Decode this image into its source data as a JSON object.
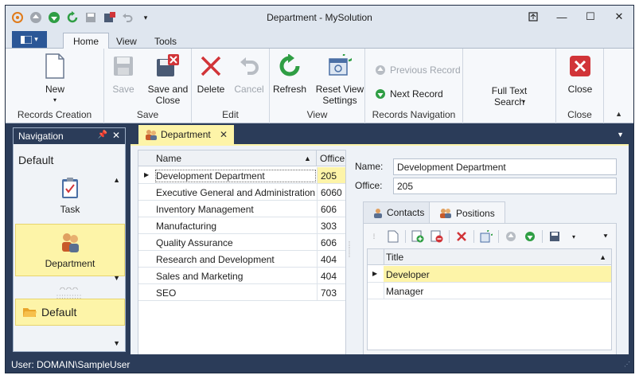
{
  "window": {
    "title": "Department - MySolution"
  },
  "ribbon": {
    "tabs": [
      "Home",
      "View",
      "Tools"
    ],
    "groups": {
      "records_creation": {
        "label": "Records Creation",
        "new_label": "New"
      },
      "save": {
        "label": "Save",
        "save_label": "Save",
        "save_close_label": "Save and Close"
      },
      "edit": {
        "label": "Edit",
        "delete_label": "Delete",
        "cancel_label": "Cancel"
      },
      "view": {
        "label": "View",
        "refresh_label": "Refresh",
        "reset_label": "Reset View Settings"
      },
      "records_navigation": {
        "label": "Records Navigation",
        "prev_label": "Previous Record",
        "next_label": "Next Record"
      },
      "search": {
        "label": "Full Text Search"
      },
      "close": {
        "label": "Close",
        "close_label": "Close"
      }
    }
  },
  "navigation": {
    "title": "Navigation",
    "group_label": "Default",
    "items": [
      {
        "label": "Task"
      },
      {
        "label": "Department"
      }
    ],
    "bottom_group": "Default"
  },
  "document": {
    "tab_label": "Department"
  },
  "grid": {
    "columns": [
      "Name",
      "Office"
    ],
    "rows": [
      {
        "name": "Development Department",
        "office": "205"
      },
      {
        "name": "Executive General and Administration",
        "office": "6060"
      },
      {
        "name": "Inventory Management",
        "office": "606"
      },
      {
        "name": "Manufacturing",
        "office": "303"
      },
      {
        "name": "Quality Assurance",
        "office": "606"
      },
      {
        "name": "Research and Development",
        "office": "404"
      },
      {
        "name": "Sales and Marketing",
        "office": "404"
      },
      {
        "name": "SEO",
        "office": "703"
      }
    ]
  },
  "detail": {
    "name_label": "Name:",
    "name_value": "Development Department",
    "office_label": "Office:",
    "office_value": "205",
    "tabs": [
      "Contacts",
      "Positions"
    ],
    "positions_columns": [
      "Title"
    ],
    "positions": [
      "Developer",
      "Manager"
    ]
  },
  "status": {
    "user_text": "User: DOMAIN\\SampleUser"
  },
  "colors": {
    "dark_frame": "#2b3c59",
    "selection": "#fdf4a8",
    "accent_blue": "#2b5797",
    "delete_red": "#d13438",
    "green": "#2f9e44"
  }
}
